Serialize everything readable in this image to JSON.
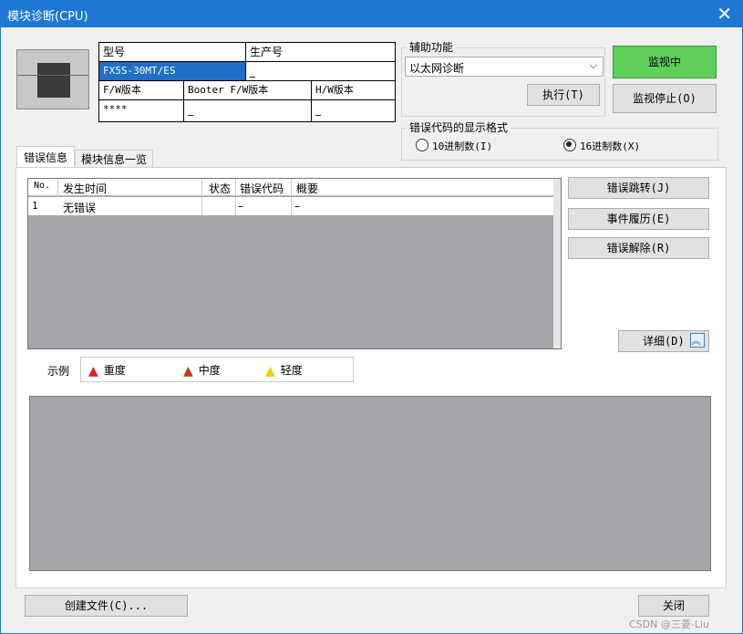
{
  "window": {
    "title": "模块诊断(CPU)",
    "close_glyph": "✕"
  },
  "module_table": {
    "h_model": "型号",
    "h_serial": "生产号",
    "model": "FX5S-30MT/ES",
    "serial": "_",
    "h_fw": "F/W版本",
    "h_booter": "Booter F/W版本",
    "h_hw": "H/W版本",
    "fw": "****",
    "booter": "_",
    "hw": "_"
  },
  "aux": {
    "label": "辅助功能",
    "selected": "以太网诊断",
    "execute": "执行(T)",
    "monitoring": "监视中",
    "stop_monitor": "监视停止(O)"
  },
  "error_format": {
    "label": "错误代码的显示格式",
    "opt_dec": "10进制数(I)",
    "opt_hex": "16进制数(X)",
    "selected": "hex"
  },
  "tabs": {
    "error_info": "错误信息",
    "module_list": "模块信息一览"
  },
  "table": {
    "headers": [
      "No.",
      "发生时间",
      "状态",
      "错误代码",
      "概要"
    ],
    "rows": [
      [
        "1",
        "无错误",
        "",
        "–",
        "–"
      ]
    ]
  },
  "actions": {
    "jump": "错误跳转(J)",
    "history": "事件履历(E)",
    "clear": "错误解除(R)",
    "detail": "详细(D)"
  },
  "legend": {
    "label": "示例",
    "major": "重度",
    "moderate": "中度",
    "minor": "轻度",
    "major_color": "#e02020",
    "moderate_color": "#c03a1a",
    "minor_color": "#f0d000"
  },
  "footer": {
    "create_file": "创建文件(C)...",
    "close": "关闭"
  },
  "watermark": "CSDN @三菱-Liu"
}
